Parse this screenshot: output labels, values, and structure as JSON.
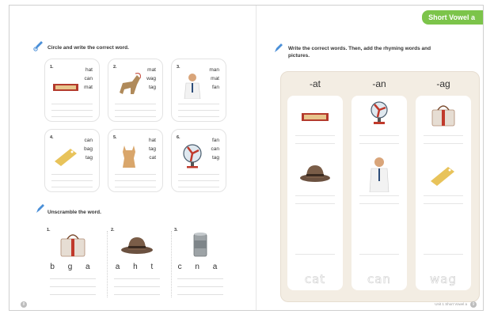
{
  "tab_label": "Short Vowel a",
  "section1": {
    "instruction": "Circle and write the correct word.",
    "cards": [
      {
        "num": "1.",
        "words": [
          "hat",
          "can",
          "mat"
        ],
        "image": "mat-icon"
      },
      {
        "num": "2.",
        "words": [
          "mat",
          "wag",
          "tag"
        ],
        "image": "dog-icon"
      },
      {
        "num": "3.",
        "words": [
          "man",
          "mat",
          "fan"
        ],
        "image": "man-icon"
      },
      {
        "num": "4.",
        "words": [
          "can",
          "bag",
          "tag"
        ],
        "image": "tag-icon"
      },
      {
        "num": "5.",
        "words": [
          "hat",
          "tag",
          "cat"
        ],
        "image": "cat-icon"
      },
      {
        "num": "6.",
        "words": [
          "fan",
          "can",
          "tag"
        ],
        "image": "fan-icon"
      }
    ]
  },
  "section2": {
    "instruction": "Unscramble the word.",
    "items": [
      {
        "num": "1.",
        "letters": "b g a",
        "image": "bag-icon"
      },
      {
        "num": "2.",
        "letters": "a h t",
        "image": "hat-icon"
      },
      {
        "num": "3.",
        "letters": "c n a",
        "image": "can-icon"
      }
    ]
  },
  "section3": {
    "instruction_line1": "Write the correct words. Then, add the rhyming words and",
    "instruction_line2": "pictures.",
    "columns": [
      {
        "heading": "-at",
        "trace": "cat",
        "images": [
          "mat-icon",
          "hat-icon"
        ]
      },
      {
        "heading": "-an",
        "trace": "can",
        "images": [
          "fan-icon",
          "man-icon"
        ]
      },
      {
        "heading": "-ag",
        "trace": "wag",
        "images": [
          "bag-icon",
          "tag-icon"
        ]
      }
    ]
  },
  "footer": {
    "left_page": "8",
    "right_text": "Unit 1 Short Vowel a",
    "right_page": "9"
  }
}
